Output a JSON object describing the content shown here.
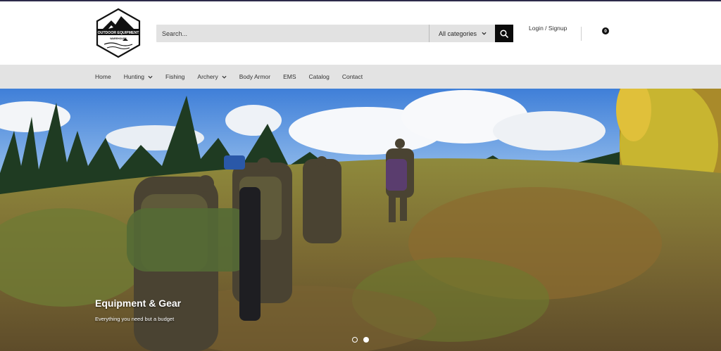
{
  "brand": {
    "logo_text_line1": "OUTDOOR EQUIPMENT",
    "logo_text_line2": "WAREHOUSE"
  },
  "search": {
    "placeholder": "Search...",
    "category_label": "All categories"
  },
  "account": {
    "login_label": "Login / Signup"
  },
  "cart": {
    "count": "0"
  },
  "nav": {
    "items": [
      {
        "label": "Home",
        "has_dropdown": false
      },
      {
        "label": "Hunting",
        "has_dropdown": true
      },
      {
        "label": "Fishing",
        "has_dropdown": false
      },
      {
        "label": "Archery",
        "has_dropdown": true
      },
      {
        "label": "Body Armor",
        "has_dropdown": false
      },
      {
        "label": "EMS",
        "has_dropdown": false
      },
      {
        "label": "Catalog",
        "has_dropdown": false
      },
      {
        "label": "Contact",
        "has_dropdown": false
      }
    ]
  },
  "hero": {
    "title": "Equipment & Gear",
    "subtitle": "Everything you need but a budget",
    "slide_count": 2,
    "active_slide": 2
  },
  "colors": {
    "top_line": "#2c2a4a",
    "nav_bg": "#e3e3e3",
    "search_bg": "#e2e2e2",
    "search_button": "#0b0b0b"
  },
  "icons": {
    "search_button": "search-icon",
    "cart": "shopping-bag-icon",
    "dropdown": "chevron-down-icon"
  }
}
